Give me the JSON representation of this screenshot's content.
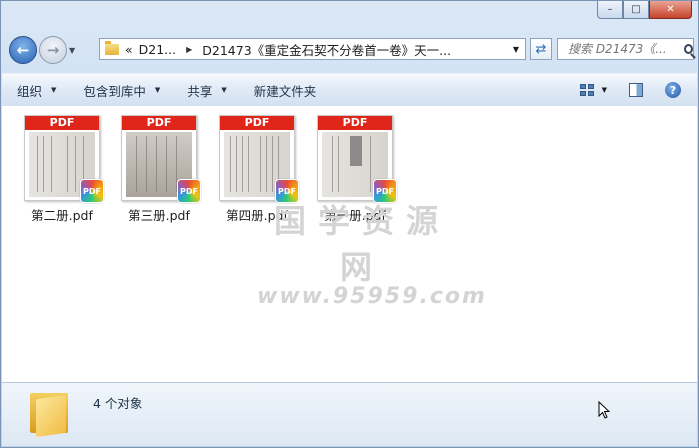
{
  "window": {
    "caption": {
      "minimize": "–",
      "maximize": "□",
      "close": "✕"
    }
  },
  "nav": {
    "history_arrow": "▼",
    "address": {
      "prefix": "«",
      "crumbs": [
        "D21...",
        "D21473《重定金石契不分卷首一卷》天一..."
      ],
      "separator": "▶",
      "dropdown": "▼"
    },
    "search": {
      "placeholder": "搜索 D21473《..."
    }
  },
  "toolbar": {
    "organize": "组织",
    "include_library": "包含到库中",
    "share": "共享",
    "new_folder": "新建文件夹",
    "dropdown_glyph": "▼",
    "help": "?"
  },
  "files": [
    {
      "name": "第二册.pdf",
      "band": "PDF",
      "badge": "PDF"
    },
    {
      "name": "第三册.pdf",
      "band": "PDF",
      "badge": "PDF"
    },
    {
      "name": "第四册.pdf",
      "band": "PDF",
      "badge": "PDF"
    },
    {
      "name": "第一册.pdf",
      "band": "PDF",
      "badge": "PDF"
    }
  ],
  "watermark": {
    "line1": "国学资源网",
    "line2": "www.95959.com"
  },
  "details": {
    "count_text": "4 个对象"
  },
  "colors": {
    "pdf_band": "#e0261b",
    "accent": "#2a62b4"
  }
}
